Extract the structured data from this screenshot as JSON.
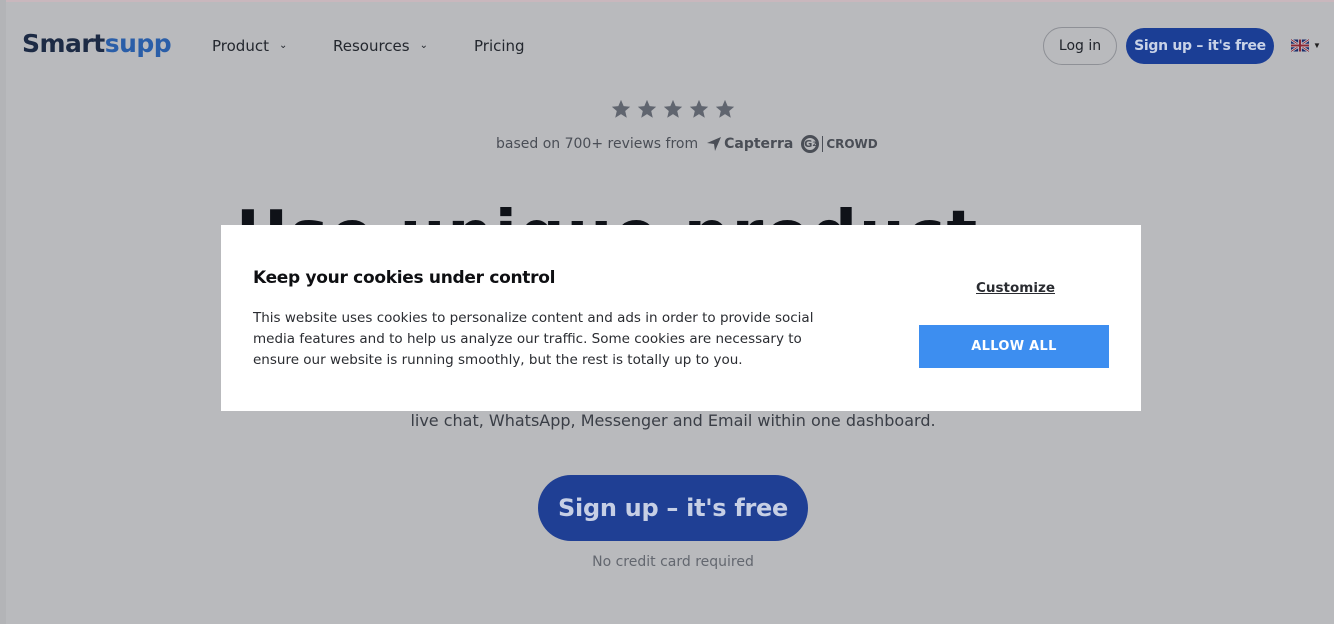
{
  "header": {
    "logo_part1": "Smart",
    "logo_part2": "supp",
    "nav": [
      {
        "label": "Product",
        "has_dropdown": true
      },
      {
        "label": "Resources",
        "has_dropdown": true
      },
      {
        "label": "Pricing",
        "has_dropdown": false
      }
    ],
    "login_label": "Log in",
    "signup_label": "Sign up – it's free",
    "language_icon": "uk-flag-icon"
  },
  "hero": {
    "rating_stars": 5,
    "reviews_text": "based on 700+ reviews from",
    "capterra_label": "Capterra",
    "g2_label": "G",
    "g2_sup": "2",
    "crowd_label": "CROWD",
    "headline_partial": "Use unique product with AI",
    "subtext": "live chat, WhatsApp, Messenger and Email within one dashboard.",
    "signup_label": "Sign up – it's free",
    "no_credit_card": "No credit card required"
  },
  "cookie_modal": {
    "title": "Keep your cookies under control",
    "body_line1": "This website uses cookies to personalize content and ads in order to provide social",
    "body_line2": "media features and to help us analyze our traffic. Some cookies are necessary to",
    "body_line3": "ensure our website is running smoothly, but the rest is totally up to you.",
    "customize_label": "Customize",
    "allow_all_label": "ALLOW ALL"
  },
  "colors": {
    "overlay_bg": "#b9babd",
    "brand_blue": "#1f3f94",
    "accept_blue": "#3d8ef0"
  }
}
